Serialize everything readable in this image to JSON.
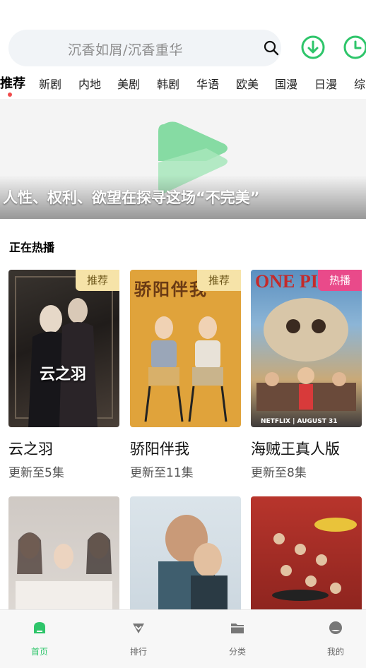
{
  "search": {
    "placeholder": "沉香如屑/沉香重华"
  },
  "tabs": [
    "推荐",
    "新剧",
    "内地",
    "美剧",
    "韩剧",
    "华语",
    "欧美",
    "国漫",
    "日漫",
    "综"
  ],
  "banner": {
    "caption": "人性、权利、欲望在探寻这场“不完美”"
  },
  "section": {
    "title": "正在热播"
  },
  "cards": [
    {
      "title": "云之羽",
      "subtitle": "更新至5集",
      "badge": "推荐",
      "poster_text": "云之羽"
    },
    {
      "title": "骄阳伴我",
      "subtitle": "更新至11集",
      "badge": "推荐",
      "poster_text": "骄阳伴我"
    },
    {
      "title": "海贼王真人版",
      "subtitle": "更新至8集",
      "badge": "热播",
      "poster_text": "ONE PIECE",
      "poster_footer": "NETFLIX | AUGUST 31"
    }
  ],
  "nav": {
    "home": "首页",
    "rank": "排行",
    "category": "分类",
    "mine": "我的"
  },
  "colors": {
    "accent": "#2ec56a",
    "badge_rec": "#f6e3a8",
    "badge_hot": "#e94a8a"
  }
}
